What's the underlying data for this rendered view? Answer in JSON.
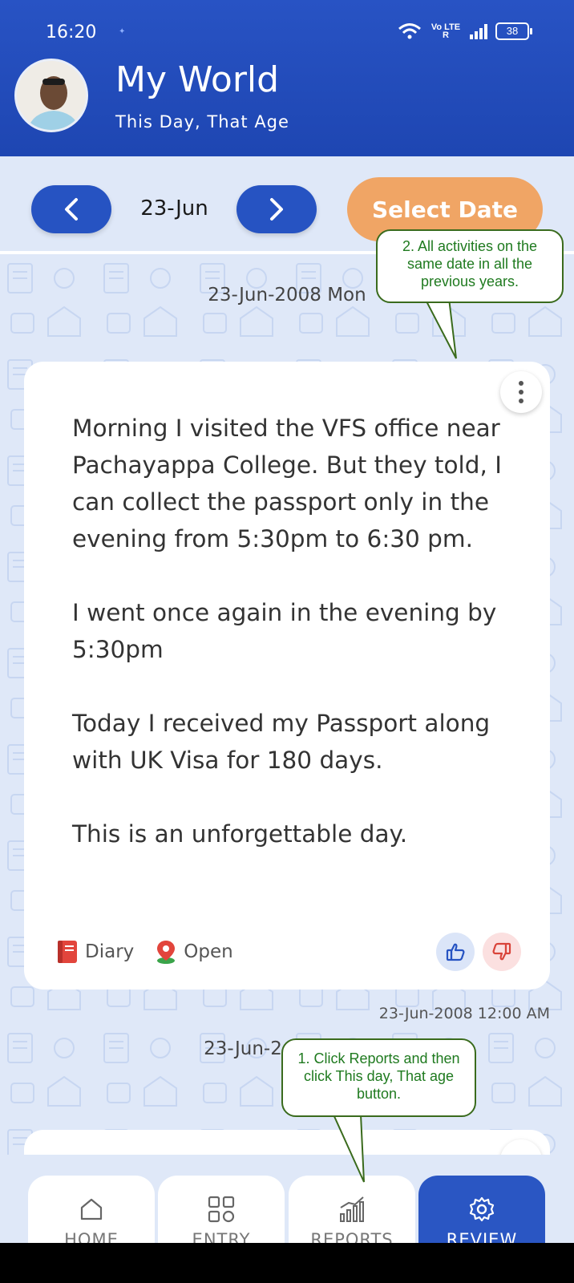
{
  "status_bar": {
    "time": "16:20",
    "network": "Vo LTE R",
    "battery": "38"
  },
  "header": {
    "title": "My World",
    "subtitle": "This Day, That Age"
  },
  "date_nav": {
    "current": "23-Jun",
    "select_label": "Select Date"
  },
  "entries": [
    {
      "date_heading": "23-Jun-2008 Mon",
      "paragraphs": [
        "Morning I visited the VFS office near Pachayappa College. But they told, I can collect the passport only in the evening from 5:30pm to 6:30 pm.",
        "I went once again in the evening by 5:30pm",
        "Today I received my Passport along with UK Visa for 180 days.",
        "This is an unforgettable day."
      ],
      "tags": {
        "type": "Diary",
        "visibility": "Open"
      },
      "timestamp": "23-Jun-2008 12:00 AM"
    },
    {
      "date_heading": "23-Jun-2"
    }
  ],
  "annotations": {
    "top": "2. All activities on the same date in all the previous years.",
    "bottom": "1. Click Reports and then click This day, That age button."
  },
  "bottom_nav": {
    "home": "HOME",
    "entry": "ENTRY",
    "reports": "REPORTS",
    "review": "REVIEW"
  },
  "colors": {
    "primary": "#2653c2",
    "accent": "#f0a565",
    "background": "#dfe8f8",
    "callout_text": "#1f7a1f"
  }
}
